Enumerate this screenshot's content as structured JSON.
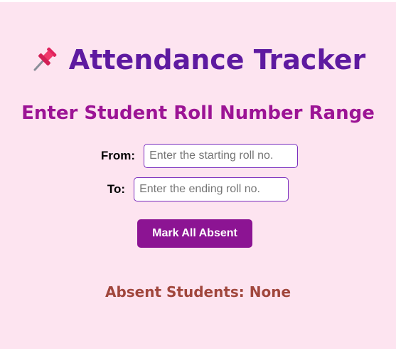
{
  "header": {
    "icon": "pushpin-icon",
    "title": "Attendance Tracker"
  },
  "form": {
    "heading": "Enter Student Roll Number Range",
    "from_label": "From:",
    "from_placeholder": "Enter the starting roll no.",
    "from_value": "",
    "to_label": "To:",
    "to_placeholder": "Enter the ending roll no.",
    "to_value": "",
    "submit_label": "Mark All Absent"
  },
  "result": {
    "absent_text": "Absent Students: None"
  },
  "colors": {
    "background": "#fde4f0",
    "title": "#5e1aa0",
    "heading": "#9c1495",
    "button": "#8c1493",
    "result": "#a0463c",
    "input_border": "#7b2fbe"
  }
}
